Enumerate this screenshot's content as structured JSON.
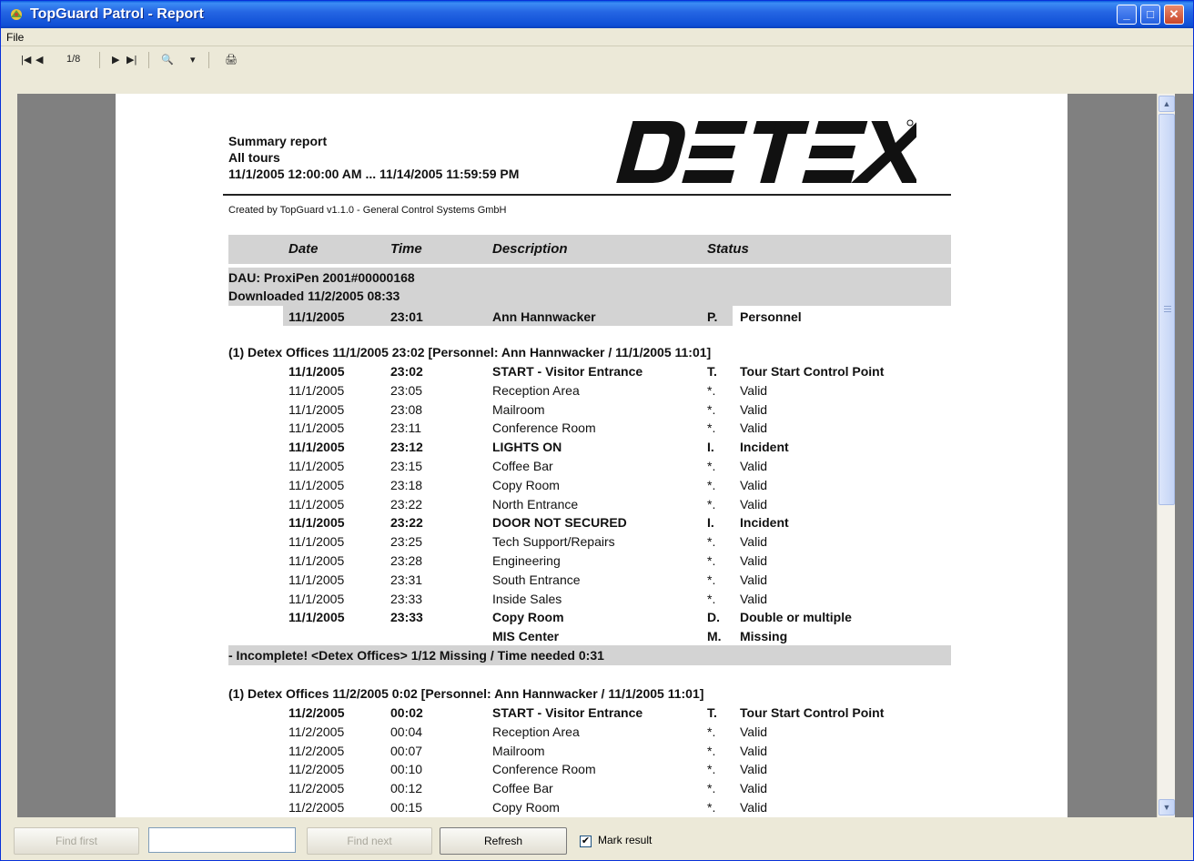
{
  "window": {
    "title": "TopGuard Patrol - Report"
  },
  "menu": {
    "file": "File"
  },
  "toolbar": {
    "page": "1/8",
    "first": "|◀",
    "prev": "◀",
    "next": "▶",
    "last": "▶|",
    "zoom": "🔍",
    "dropdown": "▾",
    "print": "🖨"
  },
  "report": {
    "title": "Summary report",
    "subtitle": "All tours",
    "range": "11/1/2005 12:00:00 AM ... 11/14/2005 11:59:59 PM",
    "logo": "DETEX",
    "created": "Created by TopGuard v1.1.0 - General Control Systems GmbH",
    "columns": [
      "Date",
      "Time",
      "Description",
      "Status"
    ],
    "dau": "DAU: ProxiPen 2001#00000168",
    "downloaded": "Downloaded 11/2/2005 08:33",
    "personnel_row": {
      "date": "11/1/2005",
      "time": "23:01",
      "desc": "Ann Hannwacker",
      "code": "P.",
      "status": "Personnel"
    },
    "tour1": {
      "header": "(1) Detex Offices 11/1/2005 23:02 [Personnel: Ann Hannwacker / 11/1/2005 11:01]",
      "rows": [
        {
          "date": "11/1/2005",
          "time": "23:02",
          "desc": "START - Visitor Entrance",
          "code": "T.",
          "status": "Tour Start Control Point",
          "bold": true
        },
        {
          "date": "11/1/2005",
          "time": "23:05",
          "desc": "Reception Area",
          "code": "*.",
          "status": "Valid",
          "bold": false
        },
        {
          "date": "11/1/2005",
          "time": "23:08",
          "desc": "Mailroom",
          "code": "*.",
          "status": "Valid",
          "bold": false
        },
        {
          "date": "11/1/2005",
          "time": "23:11",
          "desc": "Conference Room",
          "code": "*.",
          "status": "Valid",
          "bold": false
        },
        {
          "date": "11/1/2005",
          "time": "23:12",
          "desc": "LIGHTS ON",
          "code": "I.",
          "status": "Incident",
          "bold": true
        },
        {
          "date": "11/1/2005",
          "time": "23:15",
          "desc": "Coffee Bar",
          "code": "*.",
          "status": "Valid",
          "bold": false
        },
        {
          "date": "11/1/2005",
          "time": "23:18",
          "desc": "Copy Room",
          "code": "*.",
          "status": "Valid",
          "bold": false
        },
        {
          "date": "11/1/2005",
          "time": "23:22",
          "desc": "North Entrance",
          "code": "*.",
          "status": "Valid",
          "bold": false
        },
        {
          "date": "11/1/2005",
          "time": "23:22",
          "desc": "DOOR NOT SECURED",
          "code": "I.",
          "status": "Incident",
          "bold": true
        },
        {
          "date": "11/1/2005",
          "time": "23:25",
          "desc": "Tech Support/Repairs",
          "code": "*.",
          "status": "Valid",
          "bold": false
        },
        {
          "date": "11/1/2005",
          "time": "23:28",
          "desc": "Engineering",
          "code": "*.",
          "status": "Valid",
          "bold": false
        },
        {
          "date": "11/1/2005",
          "time": "23:31",
          "desc": "South Entrance",
          "code": "*.",
          "status": "Valid",
          "bold": false
        },
        {
          "date": "11/1/2005",
          "time": "23:33",
          "desc": "Inside Sales",
          "code": "*.",
          "status": "Valid",
          "bold": false
        },
        {
          "date": "11/1/2005",
          "time": "23:33",
          "desc": "Copy Room",
          "code": "D.",
          "status": "Double or multiple",
          "bold": true
        },
        {
          "date": "",
          "time": "",
          "desc": "MIS Center",
          "code": "M.",
          "status": "Missing",
          "bold": true
        }
      ],
      "summary": "- Incomplete! <Detex Offices> 1/12 Missing / Time needed 0:31"
    },
    "tour2": {
      "header": "(1) Detex Offices 11/2/2005 0:02 [Personnel: Ann Hannwacker / 11/1/2005 11:01]",
      "rows": [
        {
          "date": "11/2/2005",
          "time": "00:02",
          "desc": "START - Visitor Entrance",
          "code": "T.",
          "status": "Tour Start Control Point",
          "bold": true
        },
        {
          "date": "11/2/2005",
          "time": "00:04",
          "desc": "Reception Area",
          "code": "*.",
          "status": "Valid",
          "bold": false
        },
        {
          "date": "11/2/2005",
          "time": "00:07",
          "desc": "Mailroom",
          "code": "*.",
          "status": "Valid",
          "bold": false
        },
        {
          "date": "11/2/2005",
          "time": "00:10",
          "desc": "Conference Room",
          "code": "*.",
          "status": "Valid",
          "bold": false
        },
        {
          "date": "11/2/2005",
          "time": "00:12",
          "desc": "Coffee Bar",
          "code": "*.",
          "status": "Valid",
          "bold": false
        },
        {
          "date": "11/2/2005",
          "time": "00:15",
          "desc": "Copy Room",
          "code": "*.",
          "status": "Valid",
          "bold": false
        }
      ]
    }
  },
  "bottombar": {
    "find_first": "Find first",
    "find_value": "",
    "find_next": "Find next",
    "refresh": "Refresh",
    "mark_result": "Mark result",
    "mark_checked": "✔"
  }
}
